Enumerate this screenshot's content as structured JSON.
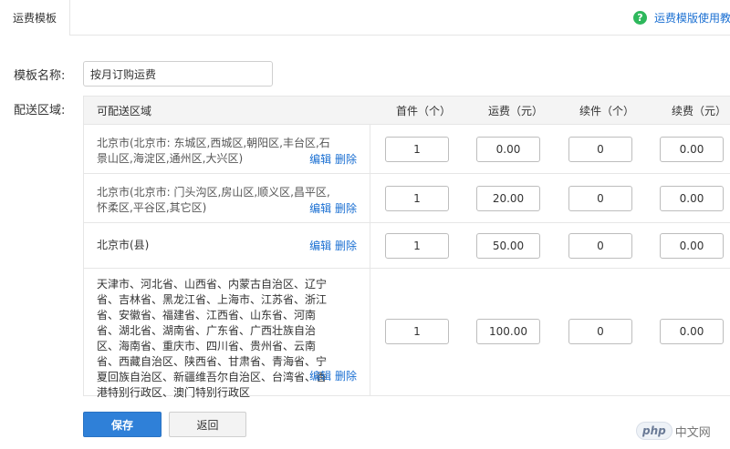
{
  "tabs": {
    "active_label": "运费模板"
  },
  "help": {
    "icon": "question-icon",
    "link_label": "运费模版使用教程"
  },
  "form": {
    "name_label": "模板名称:",
    "name_value": "按月订购运费",
    "area_label": "配送区域:"
  },
  "table": {
    "headers": [
      "可配送区域",
      "首件（个）",
      "运费（元）",
      "续件（个）",
      "续费（元）"
    ],
    "edit_label": "编辑",
    "delete_label": "删除",
    "rows": [
      {
        "region": "北京市(北京市: 东城区,西城区,朝阳区,丰台区,石景山区,海淀区,通州区,大兴区)",
        "first": "1",
        "fee": "0.00",
        "next": "0",
        "next_fee": "0.00"
      },
      {
        "region": "北京市(北京市: 门头沟区,房山区,顺义区,昌平区,怀柔区,平谷区,其它区)",
        "first": "1",
        "fee": "20.00",
        "next": "0",
        "next_fee": "0.00"
      },
      {
        "region": "北京市(县)",
        "first": "1",
        "fee": "50.00",
        "next": "0",
        "next_fee": "0.00"
      },
      {
        "region": "天津市、河北省、山西省、内蒙古自治区、辽宁省、吉林省、黑龙江省、上海市、江苏省、浙江省、安徽省、福建省、江西省、山东省、河南省、湖北省、湖南省、广东省、广西壮族自治区、海南省、重庆市、四川省、贵州省、云南省、西藏自治区、陕西省、甘肃省、青海省、宁夏回族自治区、新疆维吾尔自治区、台湾省、香港特别行政区、澳门特别行政区",
        "first": "1",
        "fee": "100.00",
        "next": "0",
        "next_fee": "0.00"
      }
    ]
  },
  "actions": {
    "save_label": "保存",
    "back_label": "返回"
  },
  "watermark": {
    "logo": "php",
    "text": "中文网"
  }
}
